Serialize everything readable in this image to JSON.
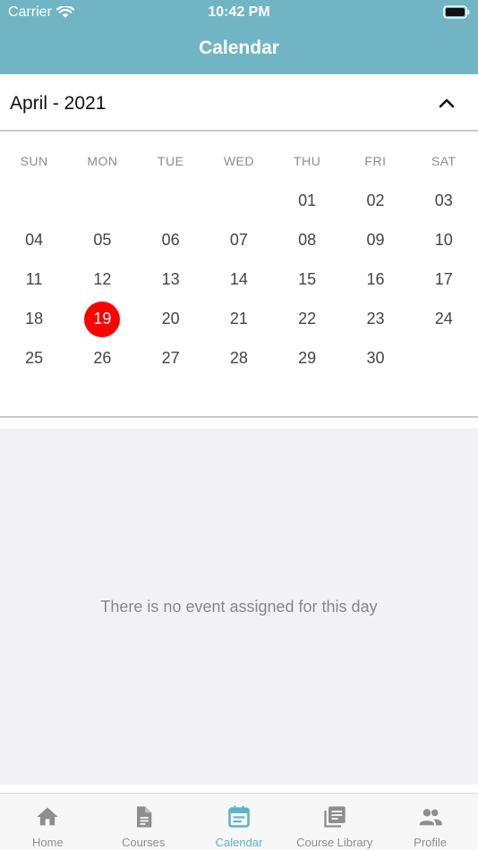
{
  "status_bar": {
    "carrier": "Carrier",
    "time": "10:42 PM"
  },
  "header": {
    "title": "Calendar"
  },
  "calendar": {
    "month_label": "April - 2021",
    "weekdays": [
      "SUN",
      "MON",
      "TUE",
      "WED",
      "THU",
      "FRI",
      "SAT"
    ],
    "first_weekday_index": 4,
    "days": [
      "01",
      "02",
      "03",
      "04",
      "05",
      "06",
      "07",
      "08",
      "09",
      "10",
      "11",
      "12",
      "13",
      "14",
      "15",
      "16",
      "17",
      "18",
      "19",
      "20",
      "21",
      "22",
      "23",
      "24",
      "25",
      "26",
      "27",
      "28",
      "29",
      "30"
    ],
    "selected_day": "19",
    "selected_color": "#ff0000"
  },
  "events": {
    "empty_message": "There is no event assigned for this day"
  },
  "tabbar": {
    "active_color": "#5fb2c6",
    "items": [
      {
        "label": "Home",
        "icon": "home-icon"
      },
      {
        "label": "Courses",
        "icon": "document-icon"
      },
      {
        "label": "Calendar",
        "icon": "calendar-icon",
        "active": true
      },
      {
        "label": "Course Library",
        "icon": "library-icon"
      },
      {
        "label": "Profile",
        "icon": "people-icon"
      }
    ]
  },
  "colors": {
    "header_bg": "#71b5c5",
    "events_bg": "#f2f2f6"
  }
}
